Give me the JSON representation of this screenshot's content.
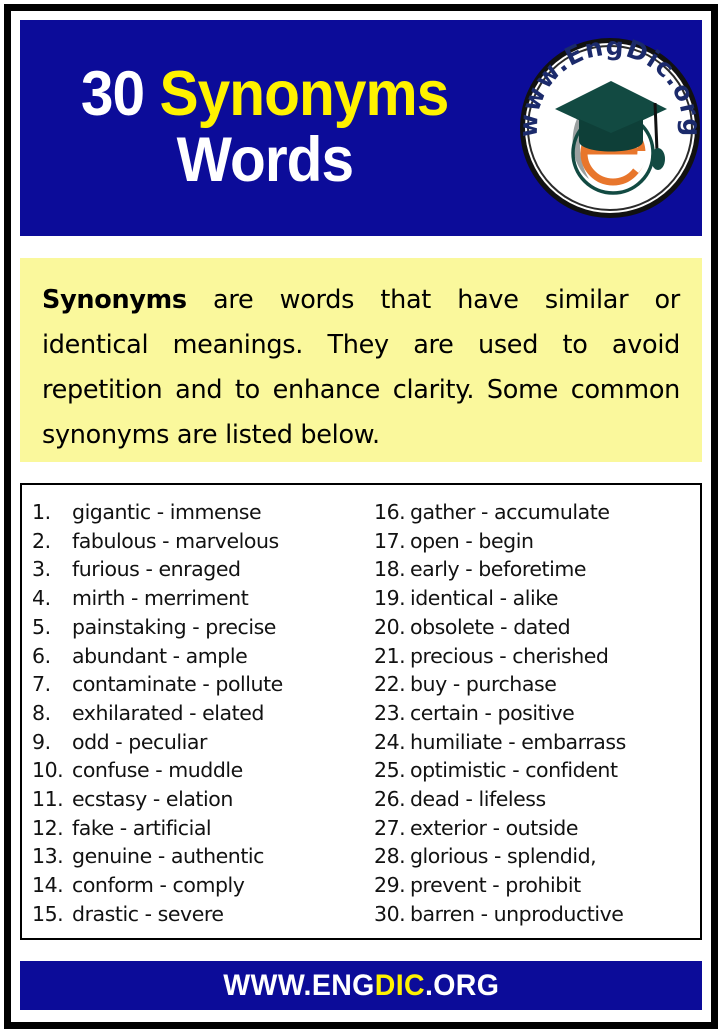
{
  "poster": {
    "colors": {
      "header_blue": "#0C0C99",
      "title_yellow": "#FFF200",
      "intro_yellow": "#FAF89C",
      "frame_black": "#000000",
      "logo_orange": "#E8762C",
      "logo_teal": "#124A42",
      "logo_navy": "#1B2A6B"
    }
  },
  "header": {
    "title_line_1_count": "30 ",
    "title_line_1_highlight": "Synonyms",
    "title_line_2": "Words",
    "logo": {
      "curved_text": "www.EngDic.org",
      "letter": "e"
    }
  },
  "intro": {
    "lead": "Synonyms",
    "body": " are words that have similar or identical meanings. They are used to avoid repetition and to enhance clarity. Some common synonyms are listed below."
  },
  "list": {
    "left_column": [
      {
        "num": "1.",
        "pair": "gigantic - immense"
      },
      {
        "num": "2.",
        "pair": "fabulous - marvelous"
      },
      {
        "num": "3.",
        "pair": "furious - enraged"
      },
      {
        "num": "4.",
        "pair": "mirth - merriment"
      },
      {
        "num": "5.",
        "pair": "painstaking - precise"
      },
      {
        "num": "6.",
        "pair": "abundant - ample"
      },
      {
        "num": "7.",
        "pair": "contaminate - pollute"
      },
      {
        "num": "8.",
        "pair": "exhilarated - elated"
      },
      {
        "num": "9.",
        "pair": "odd - peculiar"
      },
      {
        "num": "10.",
        "pair": "confuse - muddle"
      },
      {
        "num": "11.",
        "pair": "ecstasy - elation"
      },
      {
        "num": "12.",
        "pair": "fake - artificial"
      },
      {
        "num": "13.",
        "pair": "genuine - authentic"
      },
      {
        "num": "14.",
        "pair": "conform - comply"
      },
      {
        "num": "15.",
        "pair": "drastic - severe"
      }
    ],
    "right_column": [
      {
        "num": "16.",
        "pair": "gather - accumulate"
      },
      {
        "num": "17.",
        "pair": "open - begin"
      },
      {
        "num": "18.",
        "pair": "early - beforetime"
      },
      {
        "num": "19.",
        "pair": "identical - alike"
      },
      {
        "num": "20.",
        "pair": "obsolete - dated"
      },
      {
        "num": "21.",
        "pair": "precious - cherished"
      },
      {
        "num": "22.",
        "pair": "buy - purchase"
      },
      {
        "num": "23.",
        "pair": "certain - positive"
      },
      {
        "num": "24.",
        "pair": "humiliate - embarrass"
      },
      {
        "num": "25.",
        "pair": "optimistic - confident"
      },
      {
        "num": "26.",
        "pair": "dead - lifeless"
      },
      {
        "num": "27.",
        "pair": "exterior - outside"
      },
      {
        "num": "28.",
        "pair": "glorious - splendid,"
      },
      {
        "num": "29.",
        "pair": "prevent - prohibit"
      },
      {
        "num": "30.",
        "pair": "barren - unproductive"
      }
    ]
  },
  "footer": {
    "part_white_1": "WWW.ENG",
    "part_yellow": "DIC",
    "part_white_2": ".ORG"
  }
}
